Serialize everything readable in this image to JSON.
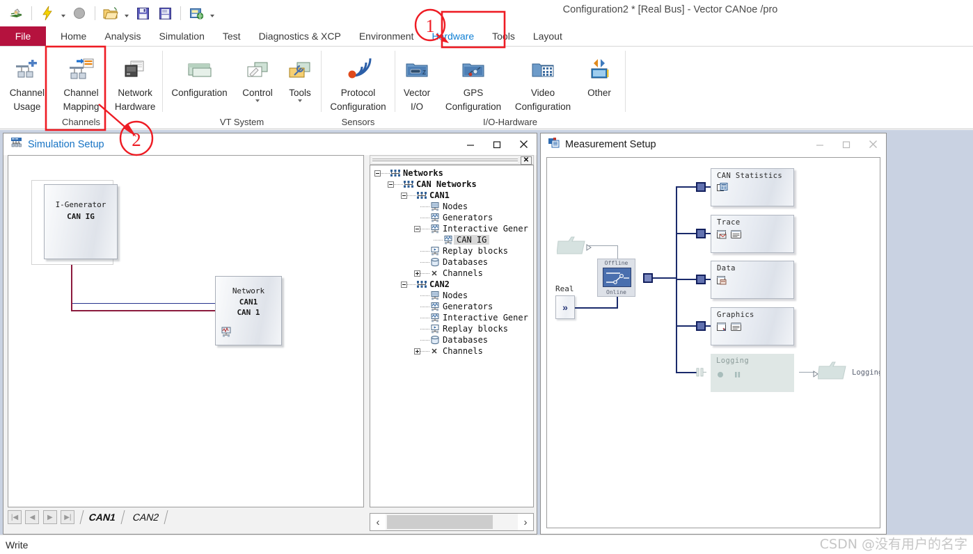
{
  "app": {
    "title": "Configuration2 * [Real Bus] - Vector CANoe /pro",
    "status_text": "Write",
    "watermark": "CSDN @没有用户的名字"
  },
  "quick_access": {
    "items": [
      {
        "name": "canoe-logo-icon",
        "label": "CANoe"
      },
      {
        "name": "start-measurement-icon",
        "label": "Start"
      },
      {
        "name": "start-dropdown-caret",
        "label": ""
      },
      {
        "name": "stop-measurement-icon",
        "label": "Stop"
      },
      {
        "name": "open-configuration-icon",
        "label": "Open"
      },
      {
        "name": "open-dropdown-caret",
        "label": ""
      },
      {
        "name": "save-configuration-icon",
        "label": "Save"
      },
      {
        "name": "save-as-icon",
        "label": "Save As"
      },
      {
        "name": "save-with-options-icon",
        "label": "Save with options"
      },
      {
        "name": "customize-qat-caret",
        "label": ""
      }
    ]
  },
  "ribbon": {
    "file_tab": "File",
    "tabs": [
      {
        "label": "Home",
        "active": false
      },
      {
        "label": "Analysis",
        "active": false
      },
      {
        "label": "Simulation",
        "active": false
      },
      {
        "label": "Test",
        "active": false
      },
      {
        "label": "Diagnostics & XCP",
        "active": false
      },
      {
        "label": "Environment",
        "active": false
      },
      {
        "label": "Hardware",
        "active": true
      },
      {
        "label": "Tools",
        "active": false
      },
      {
        "label": "Layout",
        "active": false
      }
    ],
    "groups": [
      {
        "name": "channels",
        "label": "Channels",
        "buttons": [
          {
            "label_line1": "Channel",
            "label_line2": "Usage",
            "icon": "channel-usage-icon",
            "dropdown": false,
            "highlighted": false
          },
          {
            "label_line1": "Channel",
            "label_line2": "Mapping",
            "icon": "channel-mapping-icon",
            "dropdown": false,
            "highlighted": true
          },
          {
            "label_line1": "Network",
            "label_line2": "Hardware",
            "icon": "network-hardware-icon",
            "dropdown": false,
            "highlighted": false
          }
        ]
      },
      {
        "name": "vt-system",
        "label": "VT System",
        "buttons": [
          {
            "label_line1": "Configuration",
            "label_line2": "",
            "icon": "vt-configuration-icon",
            "dropdown": false,
            "highlighted": false
          },
          {
            "label_line1": "Control",
            "label_line2": "",
            "icon": "vt-control-icon",
            "dropdown": true,
            "highlighted": false
          },
          {
            "label_line1": "Tools",
            "label_line2": "",
            "icon": "vt-tools-icon",
            "dropdown": true,
            "highlighted": false
          }
        ]
      },
      {
        "name": "sensors",
        "label": "Sensors",
        "buttons": [
          {
            "label_line1": "Protocol",
            "label_line2": "Configuration",
            "icon": "protocol-configuration-icon",
            "dropdown": false,
            "highlighted": false
          }
        ]
      },
      {
        "name": "io-hardware",
        "label": "I/O-Hardware",
        "buttons": [
          {
            "label_line1": "Vector",
            "label_line2": "I/O",
            "icon": "vector-io-icon",
            "dropdown": false,
            "highlighted": false
          },
          {
            "label_line1": "GPS",
            "label_line2": "Configuration",
            "icon": "gps-configuration-icon",
            "dropdown": false,
            "highlighted": false
          },
          {
            "label_line1": "Video",
            "label_line2": "Configuration",
            "icon": "video-configuration-icon",
            "dropdown": false,
            "highlighted": false
          },
          {
            "label_line1": "Other",
            "label_line2": "",
            "icon": "other-io-icon",
            "dropdown": false,
            "highlighted": false
          }
        ]
      }
    ]
  },
  "simulation_setup": {
    "title": "Simulation Setup",
    "window_buttons": {
      "minimize": "–",
      "maximize": "☐",
      "close": "✕"
    },
    "blocks": [
      {
        "name": "igenerator-node",
        "line1": "I-Generator",
        "line2": "CAN IG",
        "selected": true
      },
      {
        "name": "network-node",
        "line1": "Network",
        "line2": "CAN1",
        "line3": "CAN 1",
        "selected": false
      }
    ],
    "sheet_nav": [
      "first",
      "previous",
      "next",
      "last"
    ],
    "sheet_tabs": [
      {
        "label": "CAN1",
        "active": true
      },
      {
        "label": "CAN2",
        "active": false
      }
    ],
    "tree": {
      "close_button": "✕",
      "nodes": [
        {
          "depth": 0,
          "label": "Networks",
          "bold": true,
          "icon": "networks-icon",
          "expander": "minus",
          "selected": false
        },
        {
          "depth": 1,
          "label": "CAN Networks",
          "bold": true,
          "icon": "networks-icon",
          "expander": "minus",
          "selected": false
        },
        {
          "depth": 2,
          "label": "CAN1",
          "bold": true,
          "icon": "networks-icon",
          "expander": "minus",
          "selected": false
        },
        {
          "depth": 3,
          "label": "Nodes",
          "bold": false,
          "icon": "node-icon",
          "expander": "none",
          "selected": false
        },
        {
          "depth": 3,
          "label": "Generators",
          "bold": false,
          "icon": "generator-icon",
          "expander": "none",
          "selected": false
        },
        {
          "depth": 3,
          "label": "Interactive Gener",
          "bold": false,
          "icon": "generator-icon",
          "expander": "minus",
          "selected": false
        },
        {
          "depth": 4,
          "label": "CAN IG",
          "bold": false,
          "icon": "generator-icon",
          "expander": "none",
          "selected": true
        },
        {
          "depth": 3,
          "label": "Replay blocks",
          "bold": false,
          "icon": "replay-icon",
          "expander": "none",
          "selected": false
        },
        {
          "depth": 3,
          "label": "Databases",
          "bold": false,
          "icon": "database-icon",
          "expander": "none",
          "selected": false
        },
        {
          "depth": 3,
          "label": "Channels",
          "bold": false,
          "icon": "channel-x-icon",
          "expander": "plus",
          "selected": false
        },
        {
          "depth": 2,
          "label": "CAN2",
          "bold": true,
          "icon": "networks-icon",
          "expander": "minus",
          "selected": false
        },
        {
          "depth": 3,
          "label": "Nodes",
          "bold": false,
          "icon": "node-icon",
          "expander": "none",
          "selected": false
        },
        {
          "depth": 3,
          "label": "Generators",
          "bold": false,
          "icon": "generator-icon",
          "expander": "none",
          "selected": false
        },
        {
          "depth": 3,
          "label": "Interactive Gener",
          "bold": false,
          "icon": "generator-icon",
          "expander": "none",
          "selected": false
        },
        {
          "depth": 3,
          "label": "Replay blocks",
          "bold": false,
          "icon": "replay-icon",
          "expander": "none",
          "selected": false
        },
        {
          "depth": 3,
          "label": "Databases",
          "bold": false,
          "icon": "database-icon",
          "expander": "none",
          "selected": false
        },
        {
          "depth": 3,
          "label": "Channels",
          "bold": false,
          "icon": "channel-x-icon",
          "expander": "plus",
          "selected": false
        }
      ]
    },
    "hscroll": {
      "left_arrow": "‹",
      "right_arrow": "›"
    }
  },
  "measurement_setup": {
    "title": "Measurement Setup",
    "window_buttons": {
      "minimize": "–",
      "maximize": "☐",
      "close": "✕"
    },
    "source_label": "Real",
    "source_symbol": "»",
    "switch": {
      "top_label": "Offline",
      "bottom_label": "Online"
    },
    "logging_file_label": "Logging",
    "blocks": [
      {
        "name": "can-statistics-block",
        "label": "CAN Statistics",
        "icons": [
          "statistics-icon"
        ],
        "disabled": false
      },
      {
        "name": "trace-block",
        "label": "Trace",
        "icons": [
          "trace-window-icon",
          "trace-list-icon"
        ],
        "disabled": false
      },
      {
        "name": "data-block",
        "label": "Data",
        "icons": [
          "data-window-icon"
        ],
        "disabled": false
      },
      {
        "name": "graphics-block",
        "label": "Graphics",
        "icons": [
          "graphics-window-icon",
          "graphics-list-icon"
        ],
        "disabled": false
      },
      {
        "name": "logging-block",
        "label": "Logging",
        "icons": [
          "record-icon",
          "pause-icon"
        ],
        "disabled": true
      }
    ]
  },
  "annotations": [
    {
      "name": "annotation-marker-1",
      "number": "1"
    },
    {
      "name": "annotation-marker-2",
      "number": "2"
    }
  ],
  "colors": {
    "file_tab_red": "#b5123e",
    "active_tab_blue": "#0f7fd4",
    "mdi_background": "#c9d2e2",
    "annotation_red": "#ee1c24",
    "connector_navy": "#1a2a6b"
  }
}
